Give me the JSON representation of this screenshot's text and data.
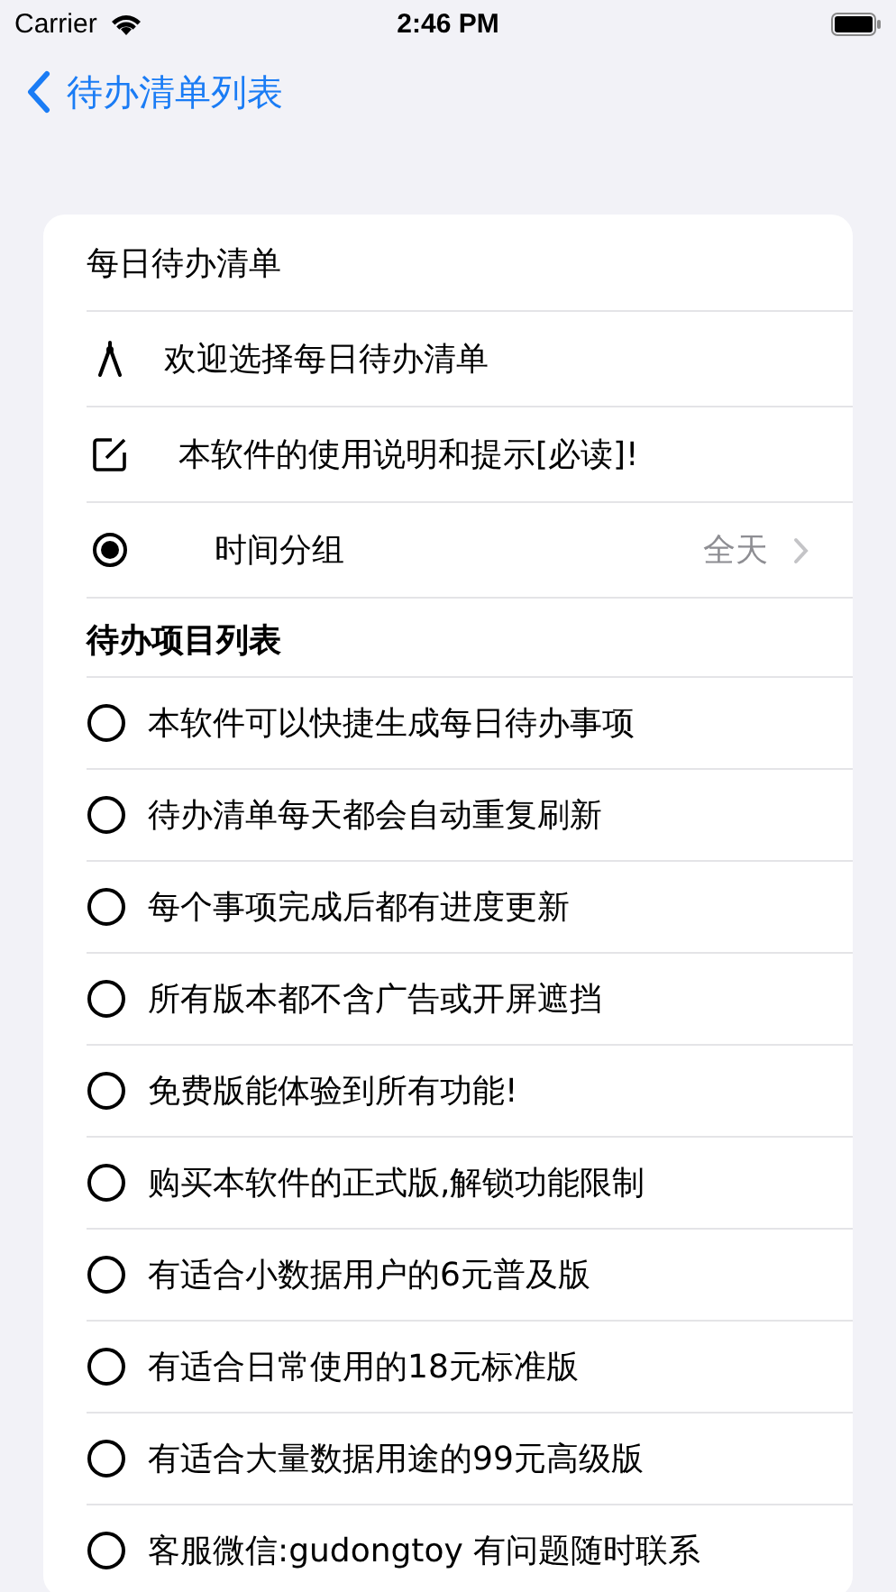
{
  "status_bar": {
    "carrier": "Carrier",
    "time": "2:46 PM"
  },
  "nav": {
    "back_label": "待办清单列表"
  },
  "card": {
    "title": "每日待办清单",
    "menu": [
      {
        "kind": "compass",
        "label": "欢迎选择每日待办清单"
      },
      {
        "kind": "edit",
        "label": "本软件的使用说明和提示[必读]!"
      },
      {
        "kind": "clock",
        "label": "时间分组",
        "value": "全天"
      }
    ],
    "section_title": "待办项目列表",
    "items": [
      {
        "label": "本软件可以快捷生成每日待办事项",
        "checked": false
      },
      {
        "label": "待办清单每天都会自动重复刷新",
        "checked": false
      },
      {
        "label": "每个事项完成后都有进度更新",
        "checked": false
      },
      {
        "label": "所有版本都不含广告或开屏遮挡",
        "checked": false
      },
      {
        "label": "免费版能体验到所有功能!",
        "checked": false
      },
      {
        "label": "购买本软件的正式版,解锁功能限制",
        "checked": false
      },
      {
        "label": "有适合小数据用户的6元普及版",
        "checked": false
      },
      {
        "label": "有适合日常使用的18元标准版",
        "checked": false
      },
      {
        "label": "有适合大量数据用途的99元高级版",
        "checked": false
      },
      {
        "label": "客服微信:gudongtoy 有问题随时联系",
        "checked": false
      }
    ]
  }
}
